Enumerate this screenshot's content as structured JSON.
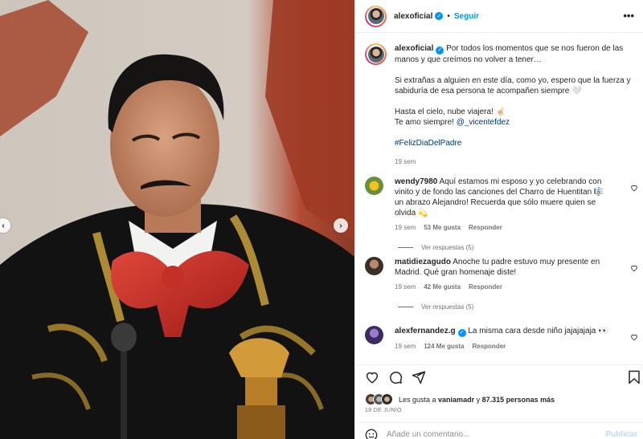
{
  "header": {
    "username": "alexoficial",
    "follow_label": "Seguir",
    "separator": "•",
    "more": "•••"
  },
  "caption": {
    "username": "alexoficial",
    "line1": " Por todos los momentos que se nos fueron de las manos y que creímos no volver a tener…",
    "paragraph2": "Si extrañas a alguien en este día, como yo, espero que la fuerza y sabiduría de esa persona te acompañen siempre 🤍",
    "paragraph3a": "Hasta el cielo, nube viajera! ☝🏻",
    "paragraph3b_prefix": "Te amo siempre! ",
    "mention": "@_vicentefdez",
    "hashtag": "#FelizDiaDelPadre",
    "time": "19 sem"
  },
  "comments": [
    {
      "username": "wendy7980",
      "text": " Aquí estamos mi esposo y yo celebrando con vinito y de fondo las canciones del Charro de Huentitan 🎼 un abrazo Alejandro! Recuerda que sólo muere quien se olvida 💫",
      "time": "19 sem",
      "likes": "53 Me gusta",
      "reply": "Responder",
      "view_replies": "Ver respuestas (5)"
    },
    {
      "username": "matidiezagudo",
      "text": " Anoche tu padre estuvo muy presente en Madrid. Qué gran homenaje diste!",
      "time": "19 sem",
      "likes": "42 Me gusta",
      "reply": "Responder",
      "view_replies": "Ver respuestas (5)"
    },
    {
      "username": "alexfernandez.g",
      "text": " La misma cara desde niño jajajajaja 👀",
      "time": "19 sem",
      "likes": "124 Me gusta",
      "reply": "Responder"
    }
  ],
  "likes": {
    "prefix": "Les gusta a ",
    "user": "vaniamadr",
    "middle": " y ",
    "count": "87.315 personas más"
  },
  "date": "18 DE JUNIO",
  "add_comment": {
    "placeholder": "Añade un comentario...",
    "publish": "Publicar"
  },
  "icons": {
    "prev": "‹",
    "next": "›",
    "verified": "✓"
  },
  "colors": {
    "accent": "#0095f6",
    "link": "#00376b",
    "muted": "#737373",
    "publish_disabled": "#b2dffc"
  }
}
